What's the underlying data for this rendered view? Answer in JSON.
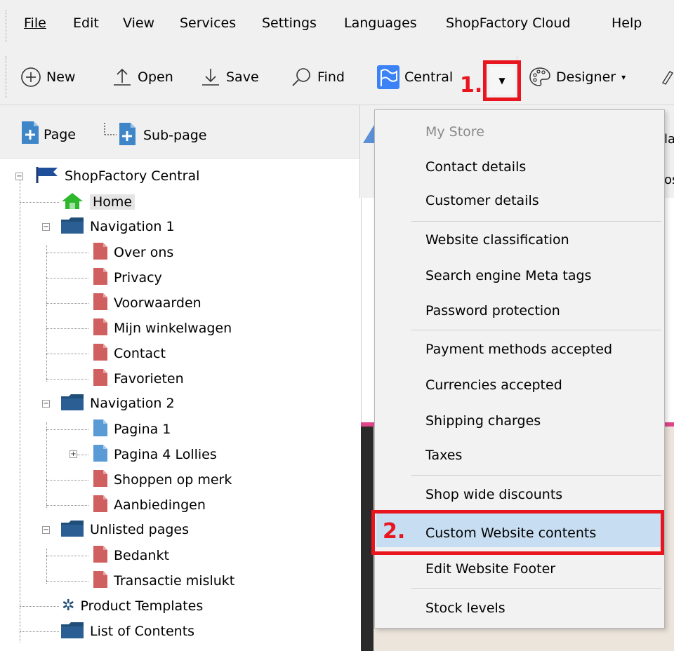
{
  "menubar": {
    "items": [
      {
        "label": "File"
      },
      {
        "label": "Edit"
      },
      {
        "label": "View"
      },
      {
        "label": "Services"
      },
      {
        "label": "Settings"
      },
      {
        "label": "Languages"
      },
      {
        "label": "ShopFactory Cloud"
      },
      {
        "label": "Help"
      }
    ]
  },
  "toolbar": {
    "new_label": "New",
    "open_label": "Open",
    "save_label": "Save",
    "find_label": "Find",
    "central_label": "Central",
    "designer_label": "Designer",
    "central_icon": "flag-wave-icon",
    "designer_icon": "palette-icon"
  },
  "annotations": {
    "step1": "1.",
    "step2": "2.",
    "color": "#e8141e"
  },
  "pagebar": {
    "page_label": "Page",
    "subpage_label": "Sub-page"
  },
  "tree": {
    "root": "ShopFactory Central",
    "home": "Home",
    "nav1": "Navigation 1",
    "nav1_children": [
      "Over ons",
      "Privacy",
      "Voorwaarden",
      "Mijn winkelwagen",
      "Contact",
      "Favorieten"
    ],
    "nav2": "Navigation 2",
    "nav2_children": [
      "Pagina 1",
      "Pagina 4 Lollies",
      "Shoppen op merk",
      "Aanbiedingen"
    ],
    "unlisted": "Unlisted pages",
    "unlisted_children": [
      "Bedankt",
      "Transactie mislukt"
    ],
    "product_templates": "Product Templates",
    "list_of_contents": "List of Contents"
  },
  "rightpane": {
    "fragment1": "la",
    "fragment2": "os"
  },
  "dropdown": {
    "header": "My Store",
    "items": [
      "Contact details",
      "Customer details",
      "Website classification",
      "Search engine Meta tags",
      "Password protection",
      "Payment methods accepted",
      "Currencies accepted",
      "Shipping charges",
      "Taxes",
      "Shop wide discounts",
      "Custom Website contents",
      "Edit Website Footer",
      "Stock levels"
    ],
    "highlighted_item": "Custom Website contents"
  },
  "colors": {
    "highlight": "#c6ddf2",
    "page_red": "#d06060",
    "page_blue": "#5b9bd5",
    "folder_navy": "#1f4e79",
    "home_green": "#2eb82e",
    "accent_pink": "#e0468a"
  }
}
